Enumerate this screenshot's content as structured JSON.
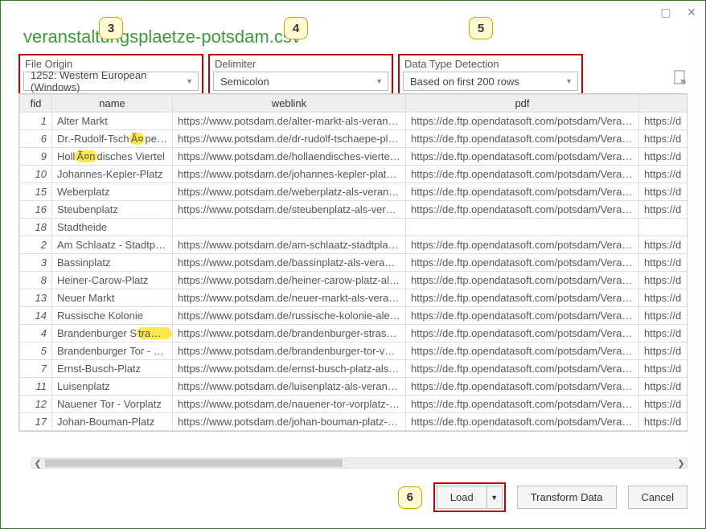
{
  "filename": "veranstaltungsplaetze-potsdam.csv",
  "options": {
    "fileOrigin": {
      "label": "File Origin",
      "value": "1252: Western European (Windows)"
    },
    "delimiter": {
      "label": "Delimiter",
      "value": "Semicolon"
    },
    "dataType": {
      "label": "Data Type Detection",
      "value": "Based on first 200 rows"
    }
  },
  "columns": [
    "fid",
    "name",
    "weblink",
    "pdf",
    ""
  ],
  "rows": [
    {
      "fid": "1",
      "name_pre": "Alter Markt",
      "hl": "",
      "name_post": "",
      "web": "https://www.potsdam.de/alter-markt-als-veranstaltun...",
      "pdf": "https://de.ftp.opendatasoft.com/potsdam/Veranstaltu...",
      "extra": "https://d"
    },
    {
      "fid": "6",
      "name_pre": "Dr.-Rudolf-Tsch",
      "hl": "Ã¤",
      "name_post": "pe-Platz",
      "web": "https://www.potsdam.de/dr-rudolf-tschaepe-platz-als-...",
      "pdf": "https://de.ftp.opendatasoft.com/potsdam/Veranstaltu...",
      "extra": "https://d"
    },
    {
      "fid": "9",
      "name_pre": "Holl",
      "hl": "Ã¤n",
      "name_post": "disches Viertel",
      "web": "https://www.potsdam.de/hollaendisches-viertel-als-ve...",
      "pdf": "https://de.ftp.opendatasoft.com/potsdam/Veranstaltu...",
      "extra": "https://d"
    },
    {
      "fid": "10",
      "name_pre": "Johannes-Kepler-Platz",
      "hl": "",
      "name_post": "",
      "web": "https://www.potsdam.de/johannes-kepler-platz-als-ver...",
      "pdf": "https://de.ftp.opendatasoft.com/potsdam/Veranstaltu...",
      "extra": "https://d"
    },
    {
      "fid": "15",
      "name_pre": "Weberplatz",
      "hl": "",
      "name_post": "",
      "web": "https://www.potsdam.de/weberplatz-als-veranstaltung...",
      "pdf": "https://de.ftp.opendatasoft.com/potsdam/Veranstaltu...",
      "extra": "https://d"
    },
    {
      "fid": "16",
      "name_pre": "Steubenplatz",
      "hl": "",
      "name_post": "",
      "web": "https://www.potsdam.de/steubenplatz-als-veranstaltu...",
      "pdf": "https://de.ftp.opendatasoft.com/potsdam/Veranstaltu...",
      "extra": "https://d"
    },
    {
      "fid": "18",
      "name_pre": "Stadtheide",
      "hl": "",
      "name_post": "",
      "web": "",
      "pdf": "",
      "extra": ""
    },
    {
      "fid": "2",
      "name_pre": "Am Schlaatz - Stadtplatz",
      "hl": "",
      "name_post": "",
      "web": "https://www.potsdam.de/am-schlaatz-stadtplatz-als-ve...",
      "pdf": "https://de.ftp.opendatasoft.com/potsdam/Veranstaltu...",
      "extra": "https://d"
    },
    {
      "fid": "3",
      "name_pre": "Bassinplatz",
      "hl": "",
      "name_post": "",
      "web": "https://www.potsdam.de/bassinplatz-als-veranstaltung...",
      "pdf": "https://de.ftp.opendatasoft.com/potsdam/Veranstaltu...",
      "extra": "https://d"
    },
    {
      "fid": "8",
      "name_pre": "Heiner-Carow-Platz",
      "hl": "",
      "name_post": "",
      "web": "https://www.potsdam.de/heiner-carow-platz-als-veran...",
      "pdf": "https://de.ftp.opendatasoft.com/potsdam/Veranstaltu...",
      "extra": "https://d"
    },
    {
      "fid": "13",
      "name_pre": "Neuer Markt",
      "hl": "",
      "name_post": "",
      "web": "https://www.potsdam.de/neuer-markt-als-veranstaltu...",
      "pdf": "https://de.ftp.opendatasoft.com/potsdam/Veranstaltu...",
      "extra": "https://d"
    },
    {
      "fid": "14",
      "name_pre": "Russische Kolonie",
      "hl": "",
      "name_post": "",
      "web": "https://www.potsdam.de/russische-kolonie-alexandro...",
      "pdf": "https://de.ftp.opendatasoft.com/potsdam/Veranstaltu...",
      "extra": "https://d"
    },
    {
      "fid": "4",
      "name_pre": "Brandenburger S",
      "hl": "traÃŸe",
      "name_post": "",
      "web": "https://www.potsdam.de/brandenburger-strasse-als-v...",
      "pdf": "https://de.ftp.opendatasoft.com/potsdam/Veranstaltu...",
      "extra": "https://d"
    },
    {
      "fid": "5",
      "name_pre": "Brandenburger Tor - Vorplatz",
      "hl": "",
      "name_post": "",
      "web": "https://www.potsdam.de/brandenburger-tor-vorplatz-...",
      "pdf": "https://de.ftp.opendatasoft.com/potsdam/Veranstaltu...",
      "extra": "https://d"
    },
    {
      "fid": "7",
      "name_pre": "Ernst-Busch-Platz",
      "hl": "",
      "name_post": "",
      "web": "https://www.potsdam.de/ernst-busch-platz-als-veranst...",
      "pdf": "https://de.ftp.opendatasoft.com/potsdam/Veranstaltu...",
      "extra": "https://d"
    },
    {
      "fid": "11",
      "name_pre": "Luisenplatz",
      "hl": "",
      "name_post": "",
      "web": "https://www.potsdam.de/luisenplatz-als-veranstaltung...",
      "pdf": "https://de.ftp.opendatasoft.com/potsdam/Veranstaltu...",
      "extra": "https://d"
    },
    {
      "fid": "12",
      "name_pre": "Nauener Tor - Vorplatz",
      "hl": "",
      "name_post": "",
      "web": "https://www.potsdam.de/nauener-tor-vorplatz-als-ver...",
      "pdf": "https://de.ftp.opendatasoft.com/potsdam/Veranstaltu...",
      "extra": "https://d"
    },
    {
      "fid": "17",
      "name_pre": "Johan-Bouman-Platz",
      "hl": "",
      "name_post": "",
      "web": "https://www.potsdam.de/johan-bouman-platz-als-vera...",
      "pdf": "https://de.ftp.opendatasoft.com/potsdam/Veranstaltu...",
      "extra": "https://d"
    }
  ],
  "callouts": {
    "c3": "3",
    "c4": "4",
    "c5": "5",
    "c6": "6"
  },
  "buttons": {
    "load": "Load",
    "transform": "Transform Data",
    "cancel": "Cancel"
  }
}
